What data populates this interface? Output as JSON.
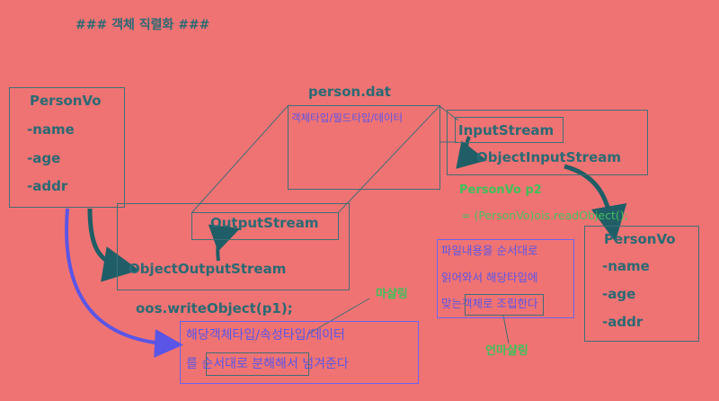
{
  "title": "### 객체 직렬화 ###",
  "left_class": {
    "name": "PersonVo",
    "fields": [
      "-name",
      "-age",
      "-addr"
    ]
  },
  "file": {
    "name": "person.dat",
    "content": "객체타입/필드타입/데이터"
  },
  "output": {
    "inner": "OutputStream",
    "outer": "ObjectOutputStream",
    "call": "oos.writeObject(p1);",
    "desc_line1": "해당객체타입/속성타입/데이터",
    "desc_line2": "를 순서대로 분해해서 넘겨준다",
    "label": "마샬링"
  },
  "input": {
    "inner": "InputStream",
    "outer": "ObjectInputStream",
    "code_line1": "PersonVo p2",
    "code_line2": "= (PersonVo)ois.readObject();",
    "desc_line1": "파일내용을 순서대로",
    "desc_line2": "읽어와서 해당타입에",
    "desc_line3": "맞는객체로 조립한다",
    "label": "언마샬링"
  },
  "right_class": {
    "name": "PersonVo",
    "fields": [
      "-name",
      "-age",
      "-addr"
    ]
  },
  "colors": {
    "background": "#f07373",
    "teal": "#2a6a74",
    "blue": "#5a55e6",
    "green": "#3fc05a",
    "box_border": "#3e6e76"
  }
}
